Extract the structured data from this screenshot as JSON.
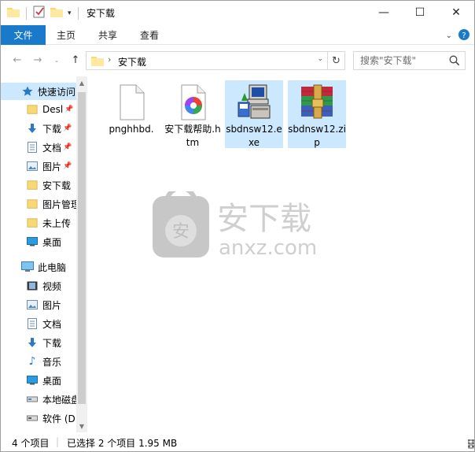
{
  "window": {
    "title": "安下载",
    "controls": {
      "minimize": "—",
      "maximize": "☐",
      "close": "✕"
    }
  },
  "ribbon": {
    "tabs": [
      {
        "label": "文件",
        "active": true
      },
      {
        "label": "主页"
      },
      {
        "label": "共享"
      },
      {
        "label": "查看"
      }
    ]
  },
  "address": {
    "path": "安下载",
    "search_placeholder": "搜索\"安下载\""
  },
  "navpane": {
    "quick_access_label": "快速访问",
    "quick_items": [
      {
        "label": "Desl",
        "icon": "folder-icon",
        "pinned": true
      },
      {
        "label": "下载",
        "icon": "download-icon",
        "pinned": true
      },
      {
        "label": "文档",
        "icon": "document-icon",
        "pinned": true
      },
      {
        "label": "图片",
        "icon": "pictures-icon",
        "pinned": true
      },
      {
        "label": "安下载",
        "icon": "folder-icon",
        "pinned": false
      },
      {
        "label": "图片管理",
        "icon": "folder-icon",
        "pinned": false
      },
      {
        "label": "未上传",
        "icon": "folder-icon",
        "pinned": false
      },
      {
        "label": "桌面",
        "icon": "desktop-icon",
        "pinned": false
      }
    ],
    "this_pc_label": "此电脑",
    "pc_items": [
      {
        "label": "视频",
        "icon": "video-icon"
      },
      {
        "label": "图片",
        "icon": "pictures-icon"
      },
      {
        "label": "文档",
        "icon": "document-icon"
      },
      {
        "label": "下载",
        "icon": "download-icon"
      },
      {
        "label": "音乐",
        "icon": "music-icon"
      },
      {
        "label": "桌面",
        "icon": "desktop-icon"
      },
      {
        "label": "本地磁盘",
        "icon": "drive-icon"
      },
      {
        "label": "软件 (D",
        "icon": "drive-icon"
      }
    ]
  },
  "files": [
    {
      "name": "pnghhbd.",
      "icon": "blank-file-icon",
      "selected": false
    },
    {
      "name": "安下载帮助.htm",
      "icon": "htm-file-icon",
      "selected": false
    },
    {
      "name": "sbdnsw12.exe",
      "icon": "installer-exe-icon",
      "selected": true
    },
    {
      "name": "sbdnsw12.zip",
      "icon": "winrar-archive-icon",
      "selected": true
    }
  ],
  "watermark": {
    "text": "安下载",
    "subtext": "anxz.com",
    "badge": "安"
  },
  "status": {
    "count": "4 个项目",
    "selection": "已选择 2 个项目 1.95 MB"
  },
  "colors": {
    "accent": "#1979ca",
    "selection": "#cce8ff"
  }
}
